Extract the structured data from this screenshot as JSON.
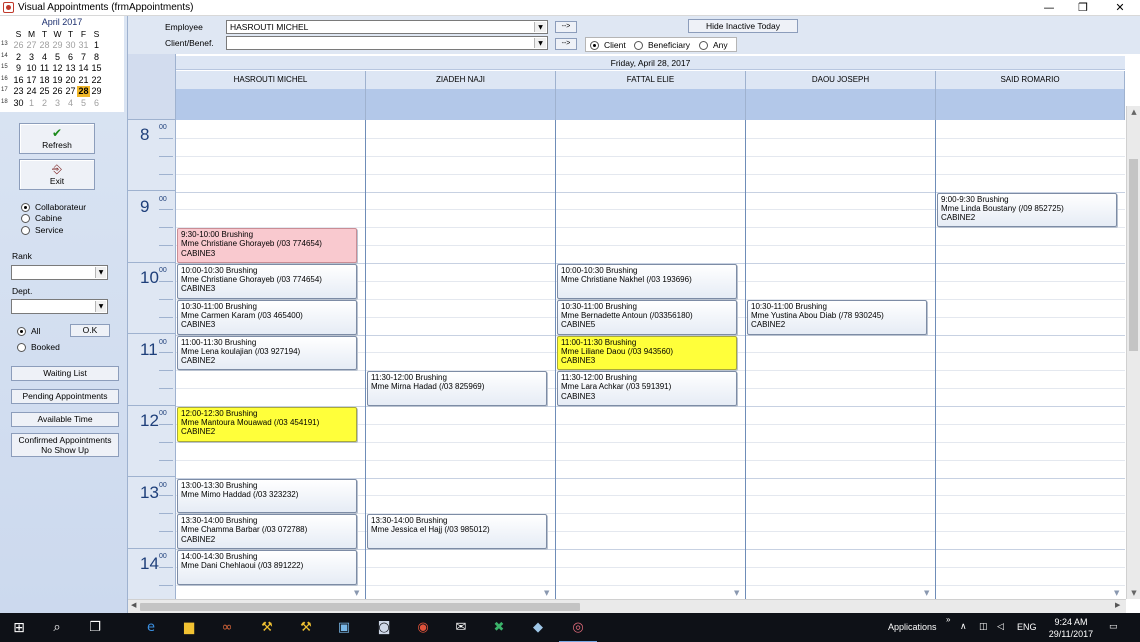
{
  "window": {
    "title": "Visual Appointments  (frmAppointments)",
    "min_glyph": "—",
    "max_glyph": "❐",
    "close_glyph": "✕"
  },
  "calendar": {
    "month": "April 2017",
    "days_header": [
      "S",
      "M",
      "T",
      "W",
      "T",
      "F",
      "S"
    ],
    "weeks": [
      {
        "wk": "13",
        "days": [
          "26",
          "27",
          "28",
          "29",
          "30",
          "31",
          "1"
        ],
        "grey": [
          0,
          1,
          2,
          3,
          4,
          5
        ]
      },
      {
        "wk": "14",
        "days": [
          "2",
          "3",
          "4",
          "5",
          "6",
          "7",
          "8"
        ],
        "grey": []
      },
      {
        "wk": "15",
        "days": [
          "9",
          "10",
          "11",
          "12",
          "13",
          "14",
          "15"
        ],
        "grey": []
      },
      {
        "wk": "16",
        "days": [
          "16",
          "17",
          "18",
          "19",
          "20",
          "21",
          "22"
        ],
        "grey": []
      },
      {
        "wk": "17",
        "days": [
          "23",
          "24",
          "25",
          "26",
          "27",
          "28",
          "29"
        ],
        "grey": [],
        "sel": 5
      },
      {
        "wk": "18",
        "days": [
          "30",
          "1",
          "2",
          "3",
          "4",
          "5",
          "6"
        ],
        "grey": [
          1,
          2,
          3,
          4,
          5,
          6
        ]
      }
    ]
  },
  "left": {
    "refresh_label": "Refresh",
    "exit_label": "Exit",
    "view_options": [
      "Collaborateur",
      "Cabine",
      "Service"
    ],
    "rank_label": "Rank",
    "dept_label": "Dept.",
    "all_label": "All",
    "booked_label": "Booked",
    "ok_label": "O.K",
    "waiting_list_label": "Waiting List",
    "pending_label": "Pending Appointments",
    "available_label": "Available Time",
    "confirmed_line1": "Confirmed Appointments",
    "confirmed_line2": "No Show Up"
  },
  "filter": {
    "employee_label": "Employee",
    "employee_value": "HASROUTI MICHEL",
    "client_label": "Client/Benef.",
    "client_value": "",
    "arrow_label": "-->",
    "hide_inactive_label": "Hide Inactive Today",
    "mode_options": [
      "Client",
      "Beneficiary",
      "Any"
    ]
  },
  "schedule": {
    "date": "Friday, April 28, 2017",
    "columns": [
      "HASROUTI MICHEL",
      "ZIADEH NAJI",
      "FATTAL ELIE",
      "DAOU JOSEPH",
      "SAID ROMARIO"
    ],
    "hours": [
      "8",
      "9",
      "10",
      "11",
      "12",
      "13",
      "14"
    ],
    "minute_label": "00",
    "appointments": [
      {
        "col": 0,
        "start": "9:30",
        "lines": [
          "9:30-10:00 Brushing",
          "Mme Christiane Ghorayeb (/03 774654)",
          "CABINE3"
        ],
        "color": "pink"
      },
      {
        "col": 0,
        "start": "10:00",
        "lines": [
          "10:00-10:30 Brushing",
          "Mme Christiane Ghorayeb (/03 774654)",
          "CABINE3"
        ],
        "color": "normal"
      },
      {
        "col": 0,
        "start": "10:30",
        "lines": [
          "10:30-11:00 Brushing",
          "Mme Carmen Karam (/03 465400)",
          "CABINE3"
        ],
        "color": "normal"
      },
      {
        "col": 0,
        "start": "11:00",
        "lines": [
          "11:00-11:30 Brushing",
          "Mme Lena koulajian (/03 927194)",
          "CABINE2"
        ],
        "color": "normal"
      },
      {
        "col": 0,
        "start": "12:00",
        "lines": [
          "12:00-12:30 Brushing",
          "Mme Mantoura Mouawad (/03 454191)",
          "CABINE2"
        ],
        "color": "yellow"
      },
      {
        "col": 0,
        "start": "13:00",
        "lines": [
          "13:00-13:30 Brushing",
          "Mme Mimo Haddad (/03 323232)",
          ""
        ],
        "color": "normal"
      },
      {
        "col": 0,
        "start": "13:30",
        "lines": [
          "13:30-14:00 Brushing",
          "Mme Chamma Barbar (/03 072788)",
          "CABINE2"
        ],
        "color": "normal"
      },
      {
        "col": 0,
        "start": "14:00",
        "lines": [
          "14:00-14:30 Brushing",
          "Mme Dani Chehlaoui (/03 891222)",
          ""
        ],
        "color": "normal"
      },
      {
        "col": 1,
        "start": "11:30",
        "lines": [
          "11:30-12:00 Brushing",
          "Mme Mirna Hadad (/03 825969)",
          ""
        ],
        "color": "normal"
      },
      {
        "col": 1,
        "start": "13:30",
        "lines": [
          "13:30-14:00 Brushing",
          "Mme Jessica el Hajj (/03 985012)",
          ""
        ],
        "color": "normal"
      },
      {
        "col": 2,
        "start": "10:00",
        "lines": [
          "10:00-10:30 Brushing",
          "Mme Christiane Nakhel (/03 193696)",
          ""
        ],
        "color": "normal"
      },
      {
        "col": 2,
        "start": "10:30",
        "lines": [
          "10:30-11:00 Brushing",
          "Mme Bernadette Antoun (/03356180)",
          "CABINE5"
        ],
        "color": "normal"
      },
      {
        "col": 2,
        "start": "11:00",
        "lines": [
          "11:00-11:30 Brushing",
          "Mme Liliane Daou (/03 943560)",
          "CABINE3"
        ],
        "color": "yellow"
      },
      {
        "col": 2,
        "start": "11:30",
        "lines": [
          "11:30-12:00 Brushing",
          "Mme Lara Achkar (/03 591391)",
          "CABINE3"
        ],
        "color": "normal"
      },
      {
        "col": 3,
        "start": "10:30",
        "lines": [
          "10:30-11:00 Brushing",
          "Mme Yustina Abou Diab (/78 930245)",
          "CABINE2"
        ],
        "color": "normal"
      },
      {
        "col": 4,
        "start": "9:00",
        "lines": [
          "9:00-9:30 Brushing",
          "Mme Linda Boustany (/09 852725)",
          "CABINE2"
        ],
        "color": "normal"
      }
    ]
  },
  "taskbar": {
    "applications_label": "Applications",
    "lang": "ENG",
    "time": "9:24 AM",
    "date": "29/11/2017"
  },
  "colors": {
    "pink": "#f9c9cf",
    "yellow": "#ffff3a",
    "header_blue": "#b3c8e9"
  }
}
